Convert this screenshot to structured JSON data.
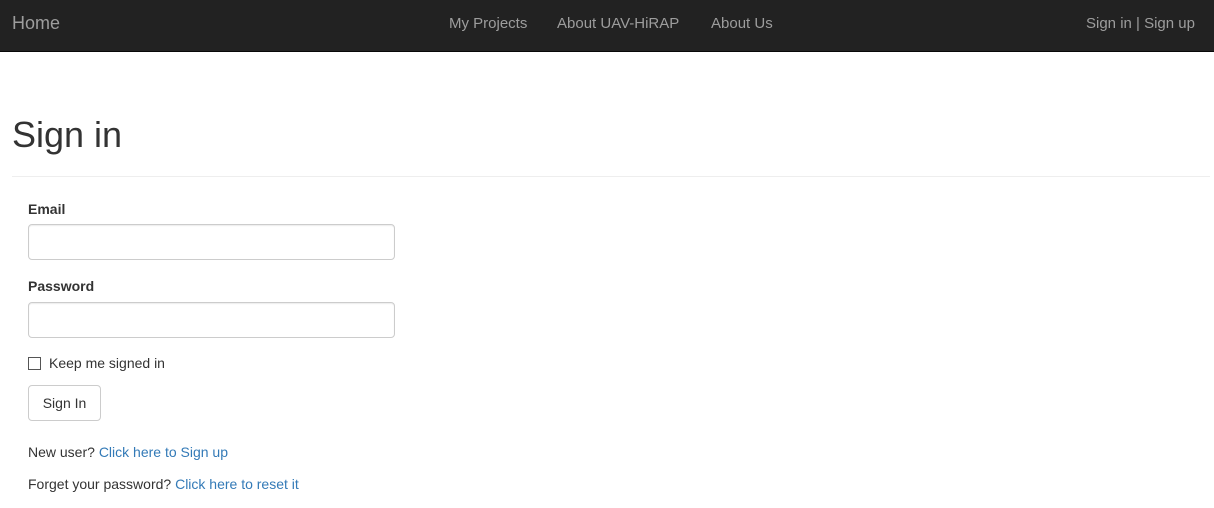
{
  "navbar": {
    "brand": "Home",
    "links": [
      "My Projects",
      "About UAV-HiRAP",
      "About Us"
    ],
    "auth": "Sign in | Sign up"
  },
  "page": {
    "title": "Sign in"
  },
  "form": {
    "email_label": "Email",
    "email_value": "",
    "password_label": "Password",
    "password_value": "",
    "remember_label": "Keep me signed in",
    "remember_checked": false,
    "submit_label": "Sign In"
  },
  "footer": {
    "new_user_text": "New user?",
    "signup_link": "Click here to Sign up",
    "forgot_text": "Forget your password?",
    "reset_link": "Click here to reset it"
  },
  "colors": {
    "navbar_bg": "#222222",
    "nav_text": "#9d9d9d",
    "link": "#337ab7"
  }
}
